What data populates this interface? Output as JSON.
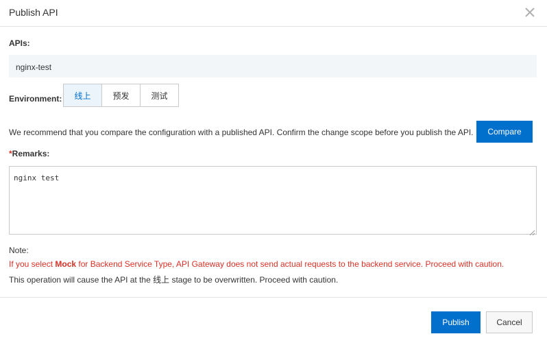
{
  "dialog": {
    "title": "Publish API",
    "close_icon": "close-icon"
  },
  "apis": {
    "label": "APIs:",
    "value": "nginx-test"
  },
  "environment": {
    "label": "Environment:",
    "options": [
      "线上",
      "预发",
      "测试"
    ],
    "selected": "线上"
  },
  "recommend": {
    "text": "We recommend that you compare the configuration with a published API. Confirm the change scope before you publish the API.",
    "compare_label": "Compare"
  },
  "remarks": {
    "required_mark": "*",
    "label": "Remarks:",
    "value": "nginx test"
  },
  "note": {
    "title": "Note:",
    "warning_prefix": "If you select ",
    "warning_bold": "Mock",
    "warning_suffix": " for Backend Service Type, API Gateway does not send actual requests to the backend service. Proceed with caution.",
    "info_prefix": "This operation will cause the API at the ",
    "info_stage": "线上",
    "info_suffix": " stage to be overwritten. Proceed with caution."
  },
  "footer": {
    "publish_label": "Publish",
    "cancel_label": "Cancel"
  },
  "colors": {
    "primary": "#0070cc",
    "warning": "#d93026",
    "active_segment_bg": "#ebf3fb"
  }
}
